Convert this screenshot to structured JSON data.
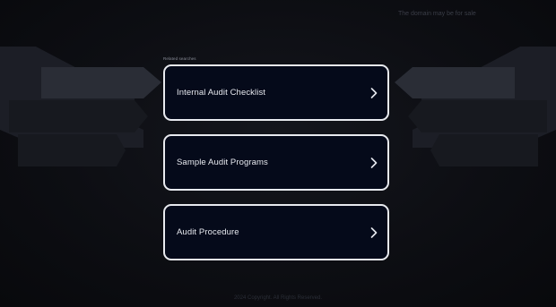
{
  "header": {
    "top_link": "The domain may be for sale"
  },
  "main": {
    "section_label": "Related searches",
    "cards": [
      {
        "label": "Internal Audit Checklist",
        "icon": "chevron-right-icon"
      },
      {
        "label": "Sample Audit Programs",
        "icon": "chevron-right-icon"
      },
      {
        "label": "Audit Procedure",
        "icon": "chevron-right-icon"
      }
    ]
  },
  "footer": {
    "text": "2024 Copyright. All Rights Reserved."
  },
  "colors": {
    "background": "#0b0c10",
    "card_background": "#050a1a",
    "card_border": "#e8eaef",
    "card_text": "#e6e8ee"
  }
}
